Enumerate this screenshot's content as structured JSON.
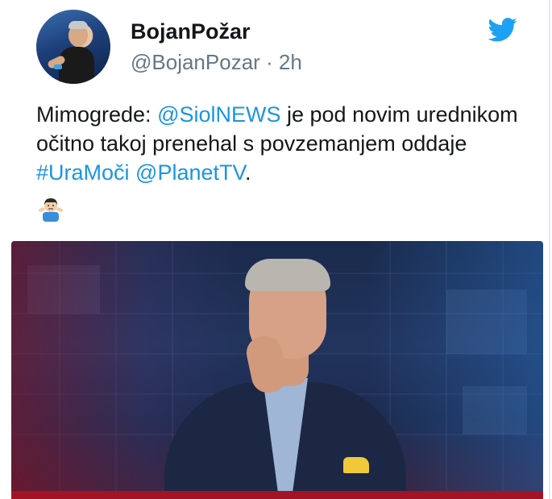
{
  "tweet": {
    "author_name": "BojanPožar",
    "handle_line": "@BojanPozar · 2h",
    "text_parts": {
      "p1": "Mimogrede: ",
      "mention1": "@SiolNEWS",
      "p2": " je pod novim urednikom očitno takoj prenehal s povzemanjem oddaje ",
      "hashtag": "#UraMoči",
      "p3": " ",
      "mention2": "@PlanetTV",
      "p4": "."
    },
    "emoji": "person-shrugging",
    "media": "photo-of-man-in-suit"
  },
  "colors": {
    "link": "#1b95e0",
    "text": "#14171a",
    "muted": "#657786",
    "twitter_blue": "#1da1f2"
  },
  "icons": [
    "twitter-bird-icon",
    "shrug-emoji-icon"
  ]
}
